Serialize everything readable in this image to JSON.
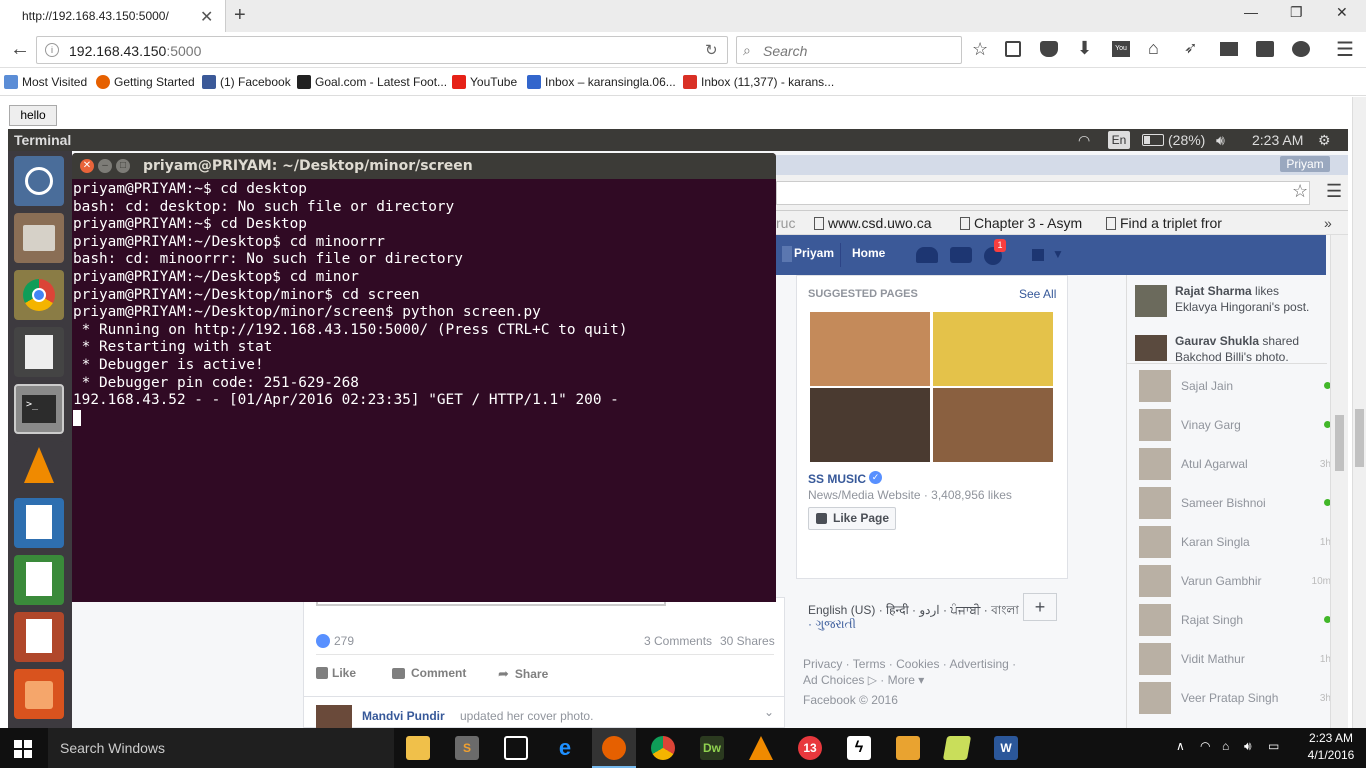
{
  "firefox": {
    "tab_title": "http://192.168.43.150:5000/",
    "url_host": "192.168.43.150",
    "url_port": ":5000",
    "search_placeholder": "Search",
    "bookmarks": [
      {
        "label": "Most Visited",
        "icon": "bookmark-folder-icon",
        "color": "#5b8dd6"
      },
      {
        "label": "Getting Started",
        "icon": "firefox-icon",
        "color": "#e66000"
      },
      {
        "label": "(1) Facebook",
        "icon": "facebook-icon",
        "color": "#3b5998"
      },
      {
        "label": "Goal.com - Latest Foot...",
        "icon": "goal-icon",
        "color": "#222"
      },
      {
        "label": "YouTube",
        "icon": "youtube-icon",
        "color": "#e62117"
      },
      {
        "label": "Inbox – karansingla.06...",
        "icon": "mail-icon",
        "color": "#3366cc"
      },
      {
        "label": "Inbox (11,377) - karans...",
        "icon": "gmail-icon",
        "color": "#d93025"
      }
    ]
  },
  "page": {
    "hello_button": "hello"
  },
  "ubuntu": {
    "topbar_title": "Terminal",
    "keyboard": "En",
    "battery": "(28%)",
    "time": "2:23 AM",
    "chrome_user": "Priyam",
    "chrome_tabs": [
      "ruc",
      "www.csd.uwo.ca",
      "Chapter 3 - Asym",
      "Find a triplet fror"
    ]
  },
  "terminal": {
    "title": "priyam@PRIYAM: ~/Desktop/minor/screen",
    "lines": [
      "priyam@PRIYAM:~$ cd desktop",
      "bash: cd: desktop: No such file or directory",
      "priyam@PRIYAM:~$ cd Desktop",
      "priyam@PRIYAM:~/Desktop$ cd minoorrr",
      "bash: cd: minoorrr: No such file or directory",
      "priyam@PRIYAM:~/Desktop$ cd minor",
      "priyam@PRIYAM:~/Desktop/minor$ cd screen",
      "priyam@PRIYAM:~/Desktop/minor/screen$ python screen.py",
      " * Running on http://192.168.43.150:5000/ (Press CTRL+C to quit)",
      " * Restarting with stat",
      " * Debugger is active!",
      " * Debugger pin code: 251-629-268",
      "192.168.43.52 - - [01/Apr/2016 02:23:35] \"GET / HTTP/1.1\" 200 -"
    ]
  },
  "facebook": {
    "nav_name": "Priyam",
    "nav_home": "Home",
    "notif_count": "1",
    "suggested_title": "SUGGESTED PAGES",
    "see_all": "See All",
    "page_name": "SS MUSIC",
    "page_meta": "News/Media Website · 3,408,956 likes",
    "like_page": "Like Page",
    "reactions": "279",
    "comments": "3 Comments",
    "shares": "30 Shares",
    "like": "Like",
    "comment": "Comment",
    "share": "Share",
    "next_post_name": "Mandvi Pundir",
    "next_post_text": "updated her cover photo.",
    "languages_line1": "English (US) · हिन्दी · اردو · ਪੰਜਾਬੀ · বাংলা",
    "languages_line2": "· ગુજરાતી",
    "footer_line1": "Privacy · Terms · Cookies · Advertising ·",
    "footer_line2": "Ad Choices ▷ · More ▾",
    "copyright": "Facebook © 2016",
    "ticker": [
      {
        "name": "Rajat Sharma",
        "text": "likes Eklavya Hingorani's post."
      },
      {
        "name": "Gaurav Shukla",
        "text": "shared Bakchod Billi's photo."
      }
    ],
    "chat": [
      {
        "name": "Sajal Jain",
        "status": "online"
      },
      {
        "name": "Vinay Garg",
        "status": "online"
      },
      {
        "name": "Atul Agarwal",
        "status": "3h"
      },
      {
        "name": "Sameer Bishnoi",
        "status": "online"
      },
      {
        "name": "Karan Singla",
        "status": "1h"
      },
      {
        "name": "Varun Gambhir",
        "status": "10m"
      },
      {
        "name": "Rajat Singh",
        "status": "online"
      },
      {
        "name": "Vidit Mathur",
        "status": "1h"
      },
      {
        "name": "Veer Pratap Singh",
        "status": "3h"
      }
    ]
  },
  "windows": {
    "search_placeholder": "Search Windows",
    "time": "2:23 AM",
    "date": "4/1/2016"
  }
}
